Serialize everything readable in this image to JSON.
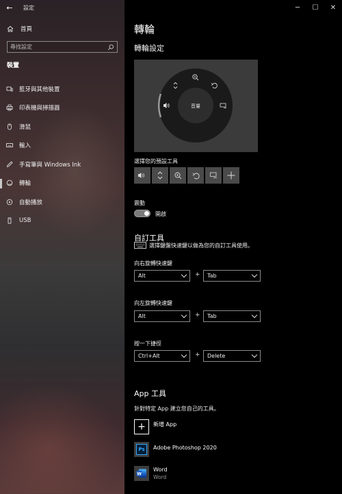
{
  "window": {
    "app_title": "設定",
    "controls": [
      "minimize",
      "maximize",
      "close"
    ]
  },
  "sidebar": {
    "home_label": "首頁",
    "search_placeholder": "尋找設定",
    "section_title": "裝置",
    "items": [
      {
        "label": "藍牙與其他裝置",
        "icon": "bluetooth-devices-icon"
      },
      {
        "label": "印表機與掃描器",
        "icon": "printer-icon"
      },
      {
        "label": "滑鼠",
        "icon": "mouse-icon"
      },
      {
        "label": "輸入",
        "icon": "keyboard-icon"
      },
      {
        "label": "手寫筆與 Windows Ink",
        "icon": "pen-icon"
      },
      {
        "label": "轉輪",
        "icon": "wheel-icon",
        "active": true
      },
      {
        "label": "自動播放",
        "icon": "autoplay-icon"
      },
      {
        "label": "USB",
        "icon": "usb-icon"
      }
    ]
  },
  "main": {
    "title": "轉輪",
    "settings_heading": "轉輪設定",
    "dial_center_label": "音量",
    "default_tools_label": "選擇您的預設工具",
    "default_tools": [
      "volume-icon",
      "scroll-icon",
      "zoom-icon",
      "undo-icon",
      "brightness-icon",
      "add-icon"
    ],
    "vibration_label": "震動",
    "vibration_state": "開啟",
    "custom_tools_heading": "自訂工具",
    "custom_tools_desc": "選擇鍵盤快速鍵以做為您的自訂工具使用。",
    "shortcuts": [
      {
        "label": "向右旋轉快速鍵",
        "modifier": "Alt",
        "key": "Tab"
      },
      {
        "label": "向左旋轉快速鍵",
        "modifier": "Alt",
        "key": "Tab"
      },
      {
        "label": "按一下捷徑",
        "modifier": "Ctrl+Alt",
        "key": "Delete"
      }
    ],
    "plus_symbol": "+",
    "app_tools_heading": "App 工具",
    "app_tools_desc": "針對特定 App 建立您自己的工具。",
    "add_app_label": "新增 App",
    "apps": [
      {
        "name": "Adobe Photoshop 2020",
        "sub": "",
        "tile_text": "Ps"
      },
      {
        "name": "Word",
        "sub": "Word",
        "tile_text": "W"
      }
    ]
  }
}
